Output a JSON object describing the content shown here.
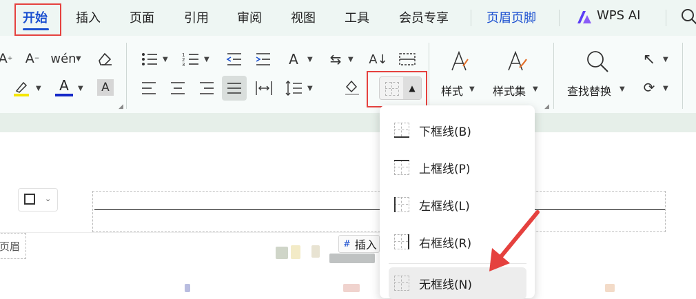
{
  "tabs": [
    {
      "label": "开始",
      "active": true
    },
    {
      "label": "插入"
    },
    {
      "label": "页面"
    },
    {
      "label": "引用"
    },
    {
      "label": "审阅"
    },
    {
      "label": "视图"
    },
    {
      "label": "工具"
    },
    {
      "label": "会员专享"
    },
    {
      "label": "页眉页脚",
      "highlight": true
    },
    {
      "label": "WPS AI"
    }
  ],
  "ribbon": {
    "style_label": "样式",
    "style_set_label": "样式集",
    "find_replace_label": "查找替换"
  },
  "document": {
    "header_tag": "页眉",
    "insert_label": "插入"
  },
  "border_menu": {
    "items": [
      {
        "label": "下框线(B)",
        "icon": "bottom-border-icon"
      },
      {
        "label": "上框线(P)",
        "icon": "top-border-icon"
      },
      {
        "label": "左框线(L)",
        "icon": "left-border-icon"
      },
      {
        "label": "右框线(R)",
        "icon": "right-border-icon"
      },
      {
        "label": "无框线(N)",
        "icon": "no-border-icon",
        "hovered": true
      }
    ]
  },
  "colors": {
    "accent_blue": "#1a4fd0",
    "highlight_red": "#e5413e",
    "tab_bg": "#eef6f3",
    "font_color_bar": "#1428c8",
    "highlighter_bar": "#f5e600"
  }
}
